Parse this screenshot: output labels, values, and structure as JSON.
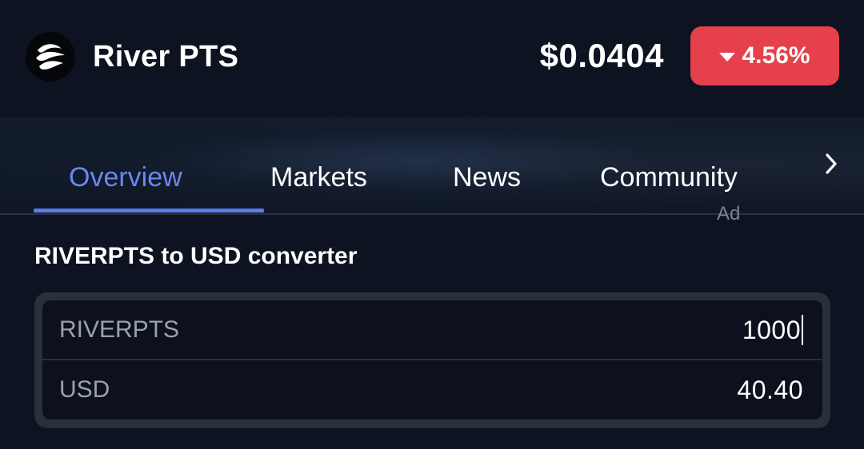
{
  "header": {
    "coin_name": "River PTS",
    "price": "$0.0404",
    "change": "4.56%",
    "change_direction": "down",
    "logo_icon": "river-logo-icon",
    "accent_down_color": "#e5404b"
  },
  "tabs": {
    "items": [
      {
        "label": "Overview",
        "active": true
      },
      {
        "label": "Markets",
        "active": false
      },
      {
        "label": "News",
        "active": false
      },
      {
        "label": "Community",
        "active": false
      }
    ],
    "more_icon": "chevron-right-icon",
    "ad_label": "Ad",
    "active_color": "#6a87ee"
  },
  "converter": {
    "title": "RIVERPTS to USD converter",
    "rows": [
      {
        "label": "RIVERPTS",
        "value": "1000"
      },
      {
        "label": "USD",
        "value": "40.40"
      }
    ]
  }
}
